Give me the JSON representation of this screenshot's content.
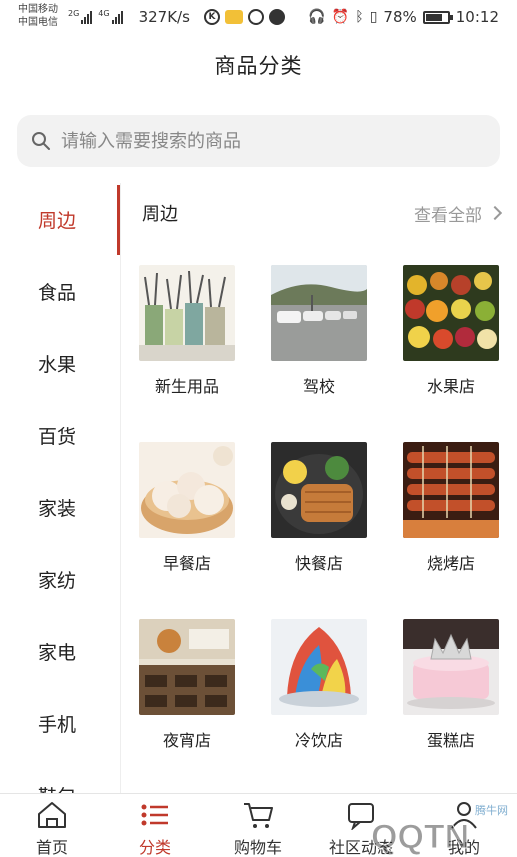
{
  "status_bar": {
    "carrier_1": "中国移动",
    "carrier_2": "中国电信",
    "net_1": "2G",
    "net_2": "4G",
    "speed": "327K/s",
    "battery": "78%",
    "battery_level": 0.78,
    "time": "10:12"
  },
  "header": {
    "title": "商品分类"
  },
  "search": {
    "placeholder": "请输入需要搜索的商品"
  },
  "sidebar": {
    "items": [
      {
        "label": "周边",
        "active": true
      },
      {
        "label": "食品"
      },
      {
        "label": "水果"
      },
      {
        "label": "百货"
      },
      {
        "label": "家装"
      },
      {
        "label": "家纺"
      },
      {
        "label": "家电"
      },
      {
        "label": "手机"
      },
      {
        "label": "鞋包"
      }
    ]
  },
  "section": {
    "title": "周边",
    "view_all": "查看全部"
  },
  "grid": {
    "items": [
      {
        "label": "新生用品",
        "icon": "stationery-image"
      },
      {
        "label": "驾校",
        "icon": "driving-school-image"
      },
      {
        "label": "水果店",
        "icon": "fruit-store-image"
      },
      {
        "label": "早餐店",
        "icon": "breakfast-image"
      },
      {
        "label": "快餐店",
        "icon": "fast-food-image"
      },
      {
        "label": "烧烤店",
        "icon": "barbecue-image"
      },
      {
        "label": "夜宵店",
        "icon": "night-snack-image"
      },
      {
        "label": "冷饮店",
        "icon": "cold-drink-image"
      },
      {
        "label": "蛋糕店",
        "icon": "cake-image"
      }
    ]
  },
  "bottom_nav": {
    "items": [
      {
        "label": "首页",
        "icon": "home-icon"
      },
      {
        "label": "分类",
        "icon": "list-icon",
        "active": true
      },
      {
        "label": "购物车",
        "icon": "cart-icon"
      },
      {
        "label": "社区动态",
        "icon": "community-icon"
      },
      {
        "label": "我的",
        "icon": "user-icon"
      }
    ]
  },
  "watermark": {
    "text": "QQTN",
    "subtext": "腾牛网"
  },
  "colors": {
    "accent": "#c0392b",
    "muted": "#999999",
    "search_bg": "#f2f2f2"
  }
}
